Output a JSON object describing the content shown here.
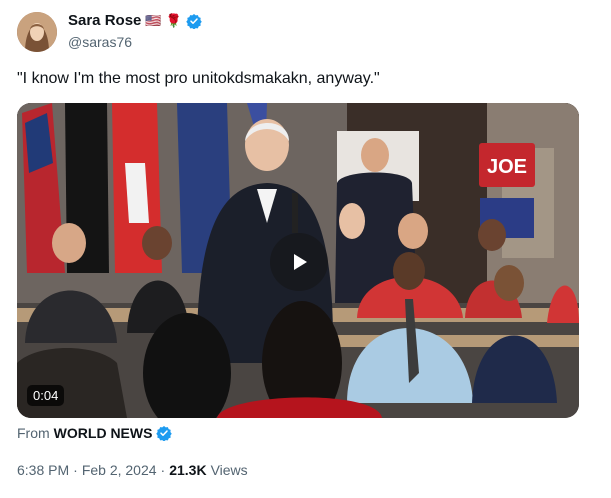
{
  "author": {
    "display_name": "Sara Rose",
    "emojis": [
      "🇺🇸",
      "🌹"
    ],
    "handle": "@saras76",
    "verified_color": "#1d9bf0"
  },
  "tweet": {
    "text": "\"I know I'm the most pro unitokdsmakakn, anyway.\""
  },
  "video": {
    "duration": "0:04",
    "sign_text": "JOE"
  },
  "source": {
    "prefix": "From",
    "name": "WORLD NEWS"
  },
  "meta": {
    "time": "6:38 PM",
    "sep1": "·",
    "date": "Feb 2, 2024",
    "sep2": "·",
    "views_count": "21.3K",
    "views_label": "Views"
  }
}
